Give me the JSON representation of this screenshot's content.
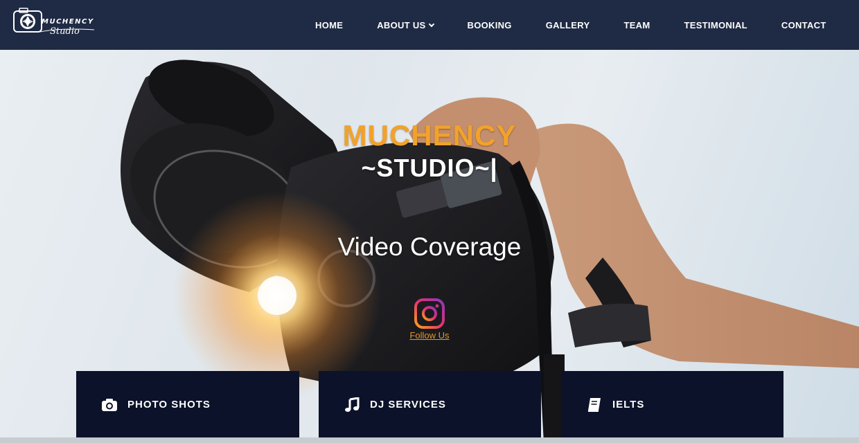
{
  "navbar": {
    "logo": {
      "top": "MUCHENCY",
      "bottom": "Studio",
      "icon": "camera-shutter-icon"
    },
    "items": [
      {
        "label": "HOME"
      },
      {
        "label": "ABOUT US",
        "icon": "chevron-down-icon"
      },
      {
        "label": "BOOKING"
      },
      {
        "label": "GALLERY"
      },
      {
        "label": "TEAM"
      },
      {
        "label": "TESTIMONIAL"
      },
      {
        "label": "CONTACT"
      }
    ]
  },
  "hero": {
    "title_line1": "MUCHENCY",
    "title_line2": "~STUDIO~|",
    "subtitle": "Video Coverage",
    "social": {
      "icon": "instagram-icon",
      "label": "Follow Us"
    }
  },
  "services": [
    {
      "label": "PHOTO SHOTS",
      "icon": "camera-icon"
    },
    {
      "label": "DJ SERVICES",
      "icon": "music-note-icon"
    },
    {
      "label": "IELTS",
      "icon": "book-icon"
    }
  ],
  "colors": {
    "navbar_bg": "#1f2a44",
    "accent_orange": "#f2a22a",
    "card_bg": "#0c1229"
  }
}
